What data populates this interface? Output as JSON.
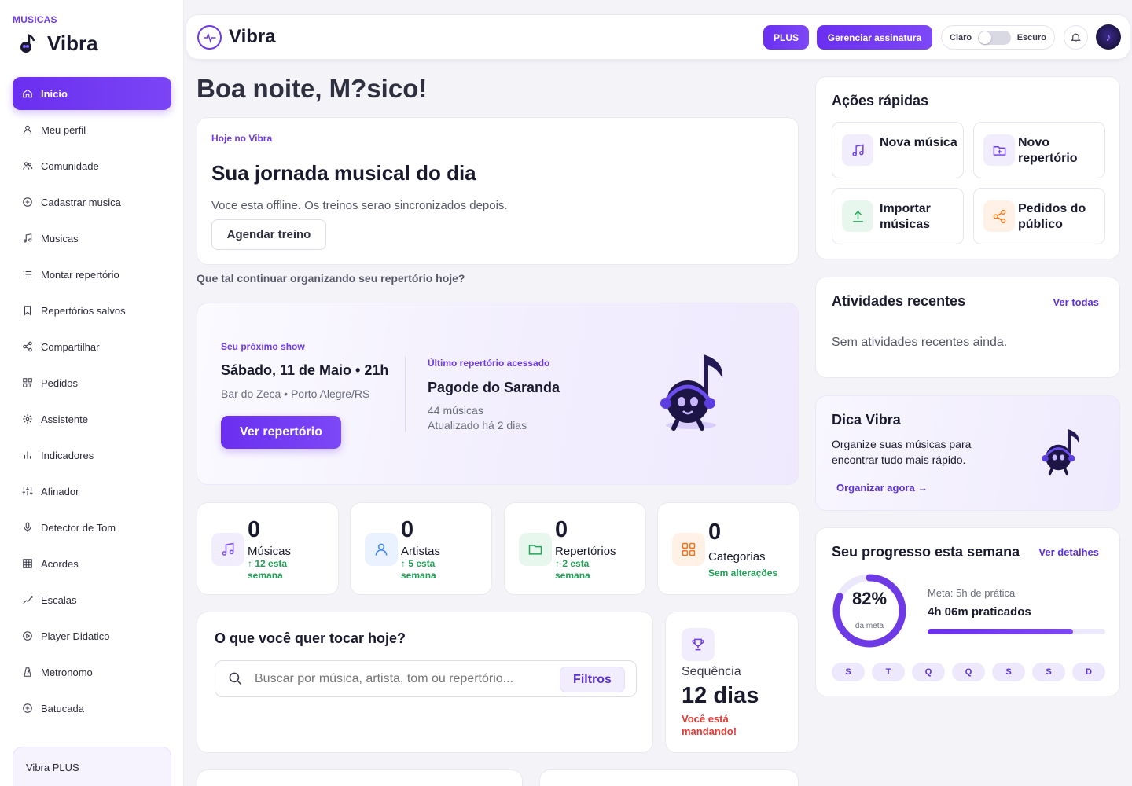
{
  "sidebar": {
    "tag": "MUSICAS",
    "brand": "Vibra",
    "items": [
      {
        "label": "Inicio",
        "icon": "home-icon",
        "active": true
      },
      {
        "label": "Meu perfil",
        "icon": "user-icon"
      },
      {
        "label": "Comunidade",
        "icon": "users-icon"
      },
      {
        "label": "Cadastrar musica",
        "icon": "plus-circle-icon"
      },
      {
        "label": "Musicas",
        "icon": "music-note-icon"
      },
      {
        "label": "Montar repertório",
        "icon": "list-icon"
      },
      {
        "label": "Repertórios salvos",
        "icon": "bookmark-icon"
      },
      {
        "label": "Compartilhar",
        "icon": "share-icon"
      },
      {
        "label": "Pedidos",
        "icon": "grid-icon"
      },
      {
        "label": "Assistente",
        "icon": "sparkle-icon"
      },
      {
        "label": "Indicadores",
        "icon": "bar-chart-icon"
      },
      {
        "label": "Afinador",
        "icon": "sliders-icon"
      },
      {
        "label": "Detector de Tom",
        "icon": "microphone-icon"
      },
      {
        "label": "Acordes",
        "icon": "chord-grid-icon"
      },
      {
        "label": "Escalas",
        "icon": "scale-icon"
      },
      {
        "label": "Player Didatico",
        "icon": "play-circle-icon"
      },
      {
        "label": "Metronomo",
        "icon": "metronome-icon"
      },
      {
        "label": "Batucada",
        "icon": "drum-icon"
      }
    ],
    "plus_label": "Vibra PLUS"
  },
  "topbar": {
    "title": "Vibra",
    "plus_button": "PLUS",
    "subscription_button": "Gerenciar assinatura",
    "theme_light": "Claro",
    "theme_dark": "Escuro"
  },
  "greeting": "Boa noite, M?sico!",
  "today": {
    "tag": "Hoje no Vibra",
    "title": "Sua jornada musical do dia",
    "message": "Voce esta offline. Os treinos serao sincronizados depois.",
    "button": "Agendar treino"
  },
  "continue_text": "Que tal continuar organizando seu repertório hoje?",
  "next_show": {
    "label": "Seu próximo show",
    "date": "Sábado, 11 de Maio • 21h",
    "venue": "Bar do Zeca • Porto Alegre/RS",
    "button": "Ver repertório",
    "last_label": "Último repertório acessado",
    "last_name": "Pagode do Saranda",
    "last_count": "44 músicas",
    "last_updated": "Atualizado há 2 dias"
  },
  "stats": [
    {
      "value": "0",
      "label": "Músicas",
      "delta": "↑ 12 esta semana",
      "color": "#7c4dff",
      "bg": "#f1edfd"
    },
    {
      "value": "0",
      "label": "Artistas",
      "delta": "↑ 5 esta semana",
      "color": "#3b82f6",
      "bg": "#eaf2ff"
    },
    {
      "value": "0",
      "label": "Repertórios",
      "delta": "↑ 2 esta semana",
      "color": "#22a559",
      "bg": "#e8f7ee"
    },
    {
      "value": "0",
      "label": "Categorias",
      "delta": "Sem alterações",
      "color": "#f97316",
      "bg": "#fff1e6"
    }
  ],
  "play": {
    "title": "O que você quer tocar hoje?",
    "placeholder": "Buscar por música, artista, tom ou repertório...",
    "filter": "Filtros"
  },
  "streak": {
    "label": "Sequência",
    "value": "12 dias",
    "message": "Você está mandando!"
  },
  "quick": {
    "title": "Ações rápidas",
    "actions": [
      {
        "label": "Nova música",
        "icon": "music-note-icon",
        "color": "#6d3ae6",
        "bg": "#f1edfd"
      },
      {
        "label": "Novo repertório",
        "icon": "folder-plus-icon",
        "color": "#6d3ae6",
        "bg": "#f1edfd"
      },
      {
        "label": "Importar músicas",
        "icon": "upload-icon",
        "color": "#22a559",
        "bg": "#e8f7ee"
      },
      {
        "label": "Pedidos do público",
        "icon": "share-icon",
        "color": "#f97316",
        "bg": "#fff1e6"
      }
    ]
  },
  "recent": {
    "title": "Atividades recentes",
    "link": "Ver todas",
    "empty": "Sem atividades recentes ainda."
  },
  "tip": {
    "title": "Dica Vibra",
    "text": "Organize suas músicas para encontrar tudo mais rápido.",
    "link": "Organizar agora →"
  },
  "progress": {
    "title": "Seu progresso esta semana",
    "link": "Ver detalhes",
    "percent": 82,
    "percent_label": "82%",
    "ring_sub": "da meta",
    "goal": "Meta: 5h de prática",
    "done": "4h 06m praticados",
    "days": [
      "S",
      "T",
      "Q",
      "Q",
      "S",
      "S",
      "D"
    ]
  },
  "colors": {
    "accent": "#6d3ae6",
    "accent_dark": "#5b32d6",
    "success": "#1fa055",
    "danger": "#e53935"
  }
}
